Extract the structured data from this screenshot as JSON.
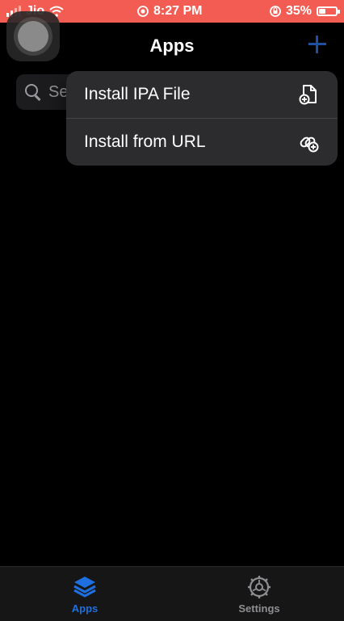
{
  "status_bar": {
    "carrier": "Jio",
    "time": "8:27 PM",
    "battery": "35%",
    "battery_level": 0.35
  },
  "header": {
    "title": "Apps"
  },
  "search": {
    "placeholder_visible": "Se"
  },
  "menu": {
    "items": [
      {
        "label": "Install IPA File",
        "icon": "file-plus-icon"
      },
      {
        "label": "Install from URL",
        "icon": "link-plus-icon"
      }
    ]
  },
  "tabbar": {
    "tabs": [
      {
        "label": "Apps",
        "icon": "stack-icon",
        "active": true
      },
      {
        "label": "Settings",
        "icon": "gear-icon",
        "active": false
      }
    ]
  },
  "colors": {
    "status_bar": "#f25c52",
    "accent": "#1e6fe0",
    "menu_bg": "#2c2c2e"
  }
}
